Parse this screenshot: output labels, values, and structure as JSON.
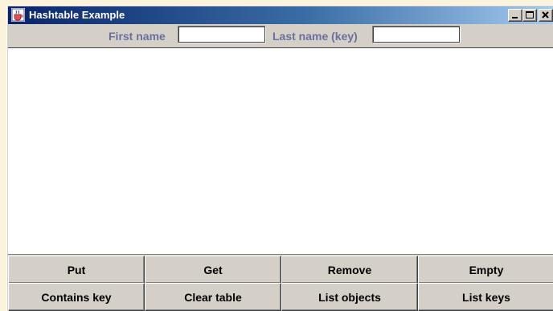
{
  "window": {
    "title": "Hashtable Example",
    "icon": "java-coffee-cup-icon"
  },
  "titlebar_buttons": {
    "minimize_icon": "minimize-icon",
    "maximize_icon": "maximize-icon",
    "close_icon": "close-icon"
  },
  "form": {
    "first_name_label": "First name",
    "first_name_value": "",
    "last_name_label": "Last name (key)",
    "last_name_value": ""
  },
  "output": {
    "text": ""
  },
  "buttons": {
    "put": "Put",
    "get": "Get",
    "remove": "Remove",
    "empty": "Empty",
    "contains_key": "Contains key",
    "clear_table": "Clear table",
    "list_objects": "List objects",
    "list_keys": "List keys"
  },
  "colors": {
    "label_color": "#6a6f9f",
    "titlebar_start": "#0a246a",
    "titlebar_end": "#a6caf0"
  }
}
